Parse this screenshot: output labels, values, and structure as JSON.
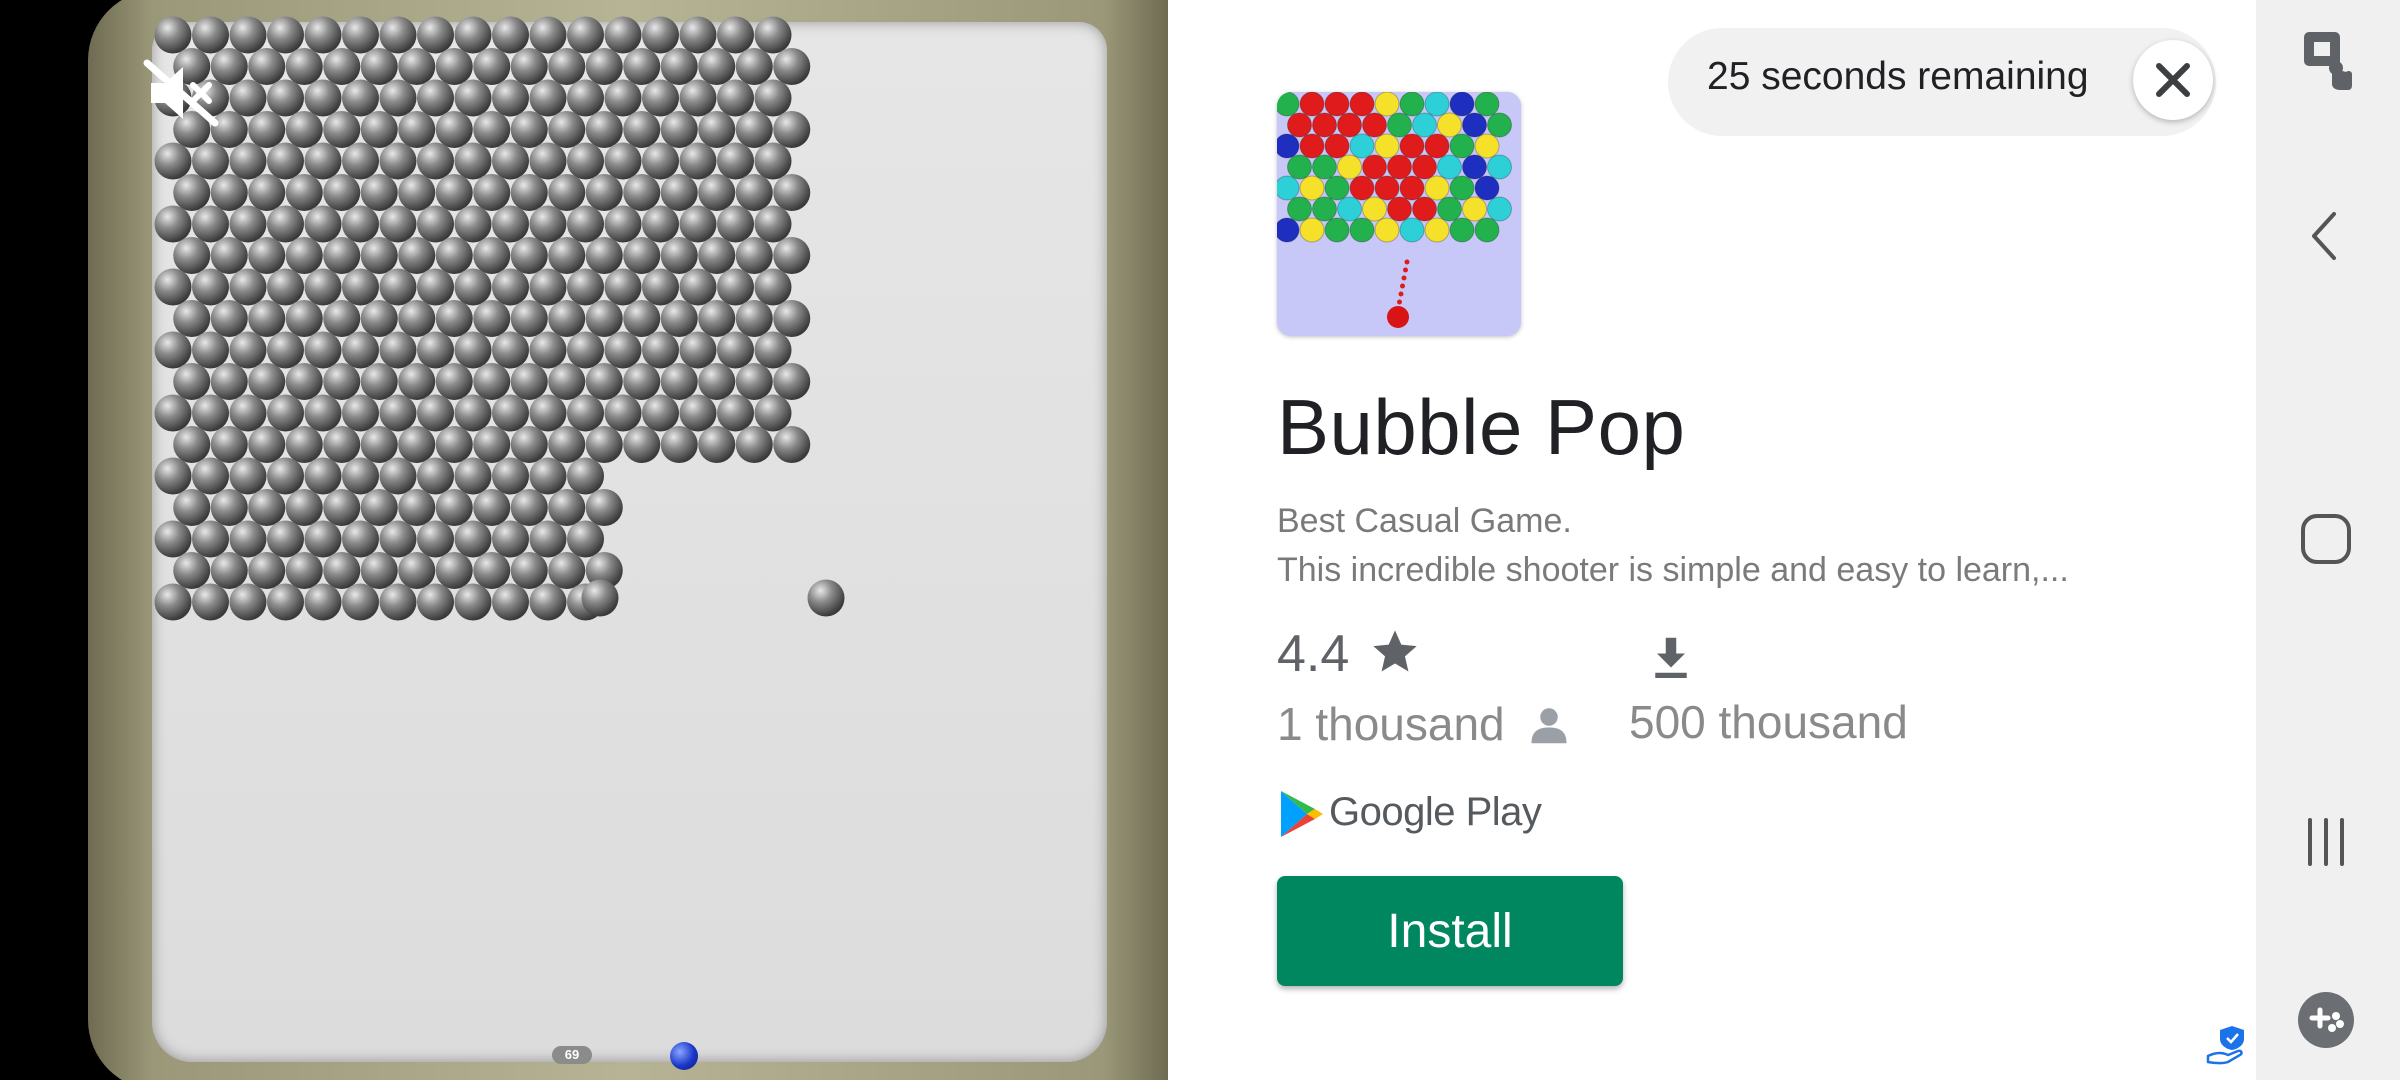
{
  "ad": {
    "timer_text": "25 seconds remaining",
    "app_title": "Bubble Pop",
    "description_line1": "Best Casual Game.",
    "description_line2": "This incredible shooter is simple and easy to learn,...",
    "rating": "4.4",
    "reviews": "1 thousand",
    "downloads": "500 thousand",
    "store_name": "Google Play",
    "install_label": "Install"
  },
  "game": {
    "ball_count": "69",
    "shooter_ball_color": "#1a37c8",
    "bubble_color": "#8a8a8a"
  },
  "colors": {
    "install_button": "#01875f",
    "title_text": "#202124",
    "secondary_text": "#7a7a7a"
  },
  "icons": {
    "mute": "volume-mute-icon",
    "close": "close-icon",
    "star": "star-icon",
    "person": "person-icon",
    "download": "download-icon",
    "store": "google-play-logo",
    "ad_choices": "ad-choices-icon",
    "sidebar": [
      "screen-touch-icon",
      "back-icon",
      "home-icon",
      "recents-icon",
      "game-tools-icon"
    ]
  }
}
